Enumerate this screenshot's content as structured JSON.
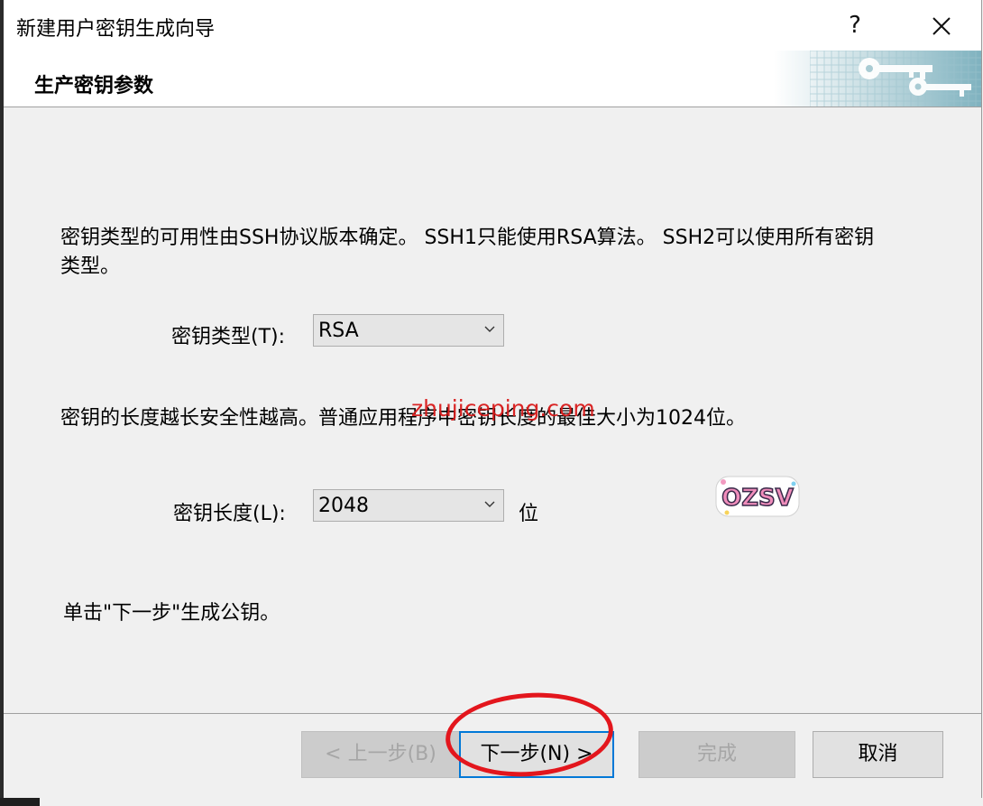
{
  "window": {
    "title": "新建用户密钥生成向导",
    "help_label": "?",
    "close_label": "✕"
  },
  "header": {
    "title": "生产密钥参数",
    "banner_icon": "keys-icon"
  },
  "content": {
    "intro_line1": "密钥类型的可用性由SSH协议版本确定。 SSH1只能使用RSA算法。 SSH2可以使用所有密钥",
    "intro_line2": "类型。",
    "key_type": {
      "label": "密钥类型(T):",
      "value": "RSA"
    },
    "length_text": "密钥的长度越长安全性越高。普通应用程序中密钥长度的最佳大小为1024位。",
    "key_length": {
      "label": "密钥长度(L):",
      "value": "2048",
      "unit": "位"
    },
    "hint": "单击\"下一步\"生成公钥。"
  },
  "watermark": "zhujiceping.com",
  "sticker_text": "OZSV",
  "buttons": {
    "back": "< 上一步(B)",
    "next": "下一步(N) >",
    "finish": "完成",
    "cancel": "取消"
  },
  "colors": {
    "accent": "#0078d7",
    "annotation": "#e3161d"
  }
}
